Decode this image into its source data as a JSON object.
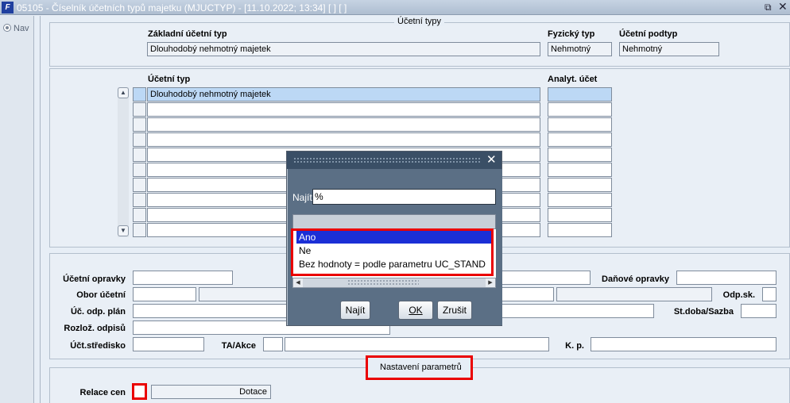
{
  "window": {
    "logo_text": "F",
    "title": "05105 - Číselník účetních typů majetku (MJUCTYP) - [11.10.2022; 13:34]  [ ]  [ ]"
  },
  "nav": {
    "label": "Nav"
  },
  "section_types": {
    "legend": "Účetní typy",
    "basic_type_label": "Základní účetní typ",
    "basic_type_value": "Dlouhodobý nehmotný majetek",
    "physical_type_label": "Fyzický typ",
    "physical_type_value": "Nehmotný",
    "subtype_label": "Účetní podtyp",
    "subtype_value": "Nehmotný"
  },
  "grid": {
    "col_type_label": "Účetní typ",
    "col_analytic_label": "Analyt. účet",
    "rows": [
      {
        "type": "Dlouhodobý nehmotný majetek",
        "analytic": ""
      },
      {
        "type": "",
        "analytic": ""
      },
      {
        "type": "",
        "analytic": ""
      },
      {
        "type": "",
        "analytic": ""
      },
      {
        "type": "",
        "analytic": ""
      },
      {
        "type": "",
        "analytic": ""
      },
      {
        "type": "",
        "analytic": ""
      },
      {
        "type": "",
        "analytic": ""
      },
      {
        "type": "",
        "analytic": ""
      },
      {
        "type": "",
        "analytic": ""
      }
    ]
  },
  "details": {
    "acc_corrections_label": "Účetní opravky",
    "tax_corrections_label": "Daňové opravky",
    "acc_range_label": "Obor účetní",
    "dep_group_label": "Odp.sk.",
    "dep_plan_label": "Úč. odp. plán",
    "period_rate_label": "St.doba/Sazba",
    "dep_split_label": "Rozlož. odpisů",
    "cost_center_label": "Účt.středisko",
    "ta_action_label": "TA/Akce",
    "kp_label": "K. p."
  },
  "settings": {
    "legend": "Nastavení parametrů",
    "price_relation_label": "Relace cen",
    "price_relation_value": "Dotace"
  },
  "dialog": {
    "find_label": "Najít",
    "find_value": "%",
    "options": [
      "Ano",
      "Ne",
      "Bez hodnoty = podle parametru UC_STAND"
    ],
    "selected_option": "Ano",
    "find_button": "Najít",
    "ok_button": "OK",
    "cancel_button": "Zrušit"
  },
  "colors": {
    "highlight": "#ea0000",
    "selection": "#1b2fd6",
    "dialog_body": "#5b6f85",
    "row_selected": "#bcd8f5"
  }
}
